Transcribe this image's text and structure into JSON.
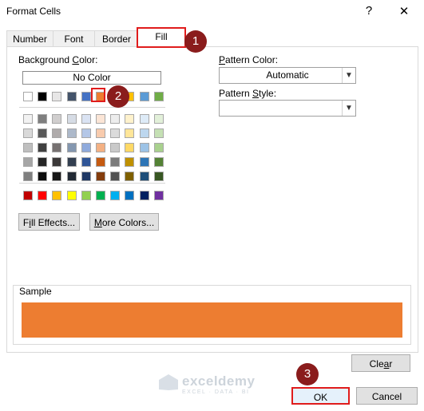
{
  "window": {
    "title": "Format Cells",
    "help_glyph": "?",
    "close_glyph": "✕"
  },
  "tabs": [
    {
      "label": "Number"
    },
    {
      "label": "Font"
    },
    {
      "label": "Border"
    },
    {
      "label": "Fill"
    }
  ],
  "background_color": {
    "label": "Background Color:",
    "no_color_label": "No Color",
    "theme_top_row": [
      "#FFFFFF",
      "#000000",
      "#E7E6E6",
      "#44546A",
      "#4472C4",
      "#ED7D31",
      "#A5A5A5",
      "#FFC000",
      "#5B9BD5",
      "#70AD47"
    ],
    "theme_shades": [
      [
        "#F2F2F2",
        "#7F7F7F",
        "#D0CECE",
        "#D6DCE5",
        "#DAE3F3",
        "#FBE5D6",
        "#EDEDED",
        "#FFF2CC",
        "#DEEBF7",
        "#E2F0D9"
      ],
      [
        "#D9D9D9",
        "#595959",
        "#AFABAB",
        "#ADB9CA",
        "#B4C7E7",
        "#F8CBAD",
        "#DBDBDB",
        "#FFE699",
        "#BDD7EE",
        "#C5E0B4"
      ],
      [
        "#BFBFBF",
        "#404040",
        "#767171",
        "#8497B0",
        "#8FAADC",
        "#F4B183",
        "#C9C9C9",
        "#FFD966",
        "#9DC3E6",
        "#A9D18E"
      ],
      [
        "#A6A6A6",
        "#262626",
        "#3B3838",
        "#333F50",
        "#2F5597",
        "#C55A11",
        "#7B7B7B",
        "#BF9000",
        "#2E75B6",
        "#548235"
      ],
      [
        "#7F7F7F",
        "#0D0D0D",
        "#171717",
        "#222A35",
        "#1F3864",
        "#843C0C",
        "#525252",
        "#7F6000",
        "#1F4E79",
        "#385723"
      ]
    ],
    "standard_colors": [
      "#C00000",
      "#FF0000",
      "#FFC000",
      "#FFFF00",
      "#92D050",
      "#00B050",
      "#00B0F0",
      "#0070C0",
      "#002060",
      "#7030A0"
    ],
    "selected_color": "#ED7D31"
  },
  "buttons": {
    "fill_effects": "Fill Effects...",
    "more_colors": "More Colors...",
    "clear": "Clear",
    "ok": "OK",
    "cancel": "Cancel"
  },
  "pattern": {
    "color_label": "Pattern Color:",
    "color_value": "Automatic",
    "style_label": "Pattern Style:",
    "style_value": ""
  },
  "sample": {
    "label": "Sample",
    "color": "#ED7D31"
  },
  "markers": [
    "1",
    "2",
    "3"
  ],
  "watermark": {
    "brand": "exceldemy",
    "tagline": "EXCEL · DATA · BI"
  }
}
